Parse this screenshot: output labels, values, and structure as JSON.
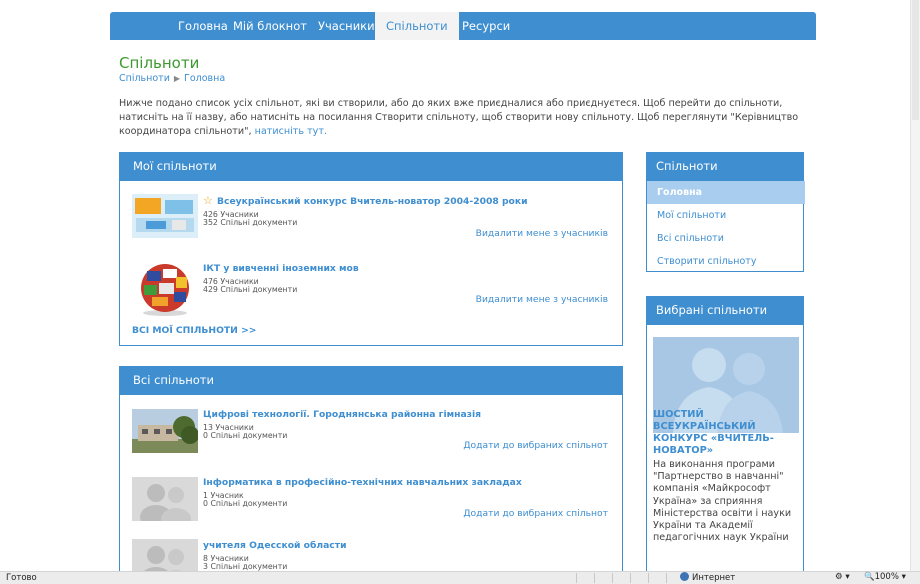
{
  "nav": {
    "items": [
      {
        "label": "Головна"
      },
      {
        "label": "Мій блокнот"
      },
      {
        "label": "Учасники"
      },
      {
        "label": "Спільноти"
      },
      {
        "label": "Ресурси"
      }
    ],
    "active": "Спільноти"
  },
  "page": {
    "title": "Спільноти",
    "breadcrumb": [
      "Спільноти",
      "Головна"
    ],
    "intro_text": "Нижче подано список усіх спільнот, які ви створили, або до яких вже приєдналися або приєднуєтеся. Щоб перейти до спільноти, натисніть на її назву, або натисніть на посилання Створити спільноту, щоб створити нову спільноту. Щоб переглянути \"Керівництво координатора спільноти\",",
    "intro_link": "натисніть тут."
  },
  "my_communities": {
    "heading": "Мої спільноти",
    "items": [
      {
        "title": "Всеукраїнський конкурс Вчитель-новатор 2004-2008 роки",
        "members": "426 Учасники",
        "docs": "352 Спільні документи",
        "action": "Видалити мене з учасників",
        "icon": "star-icon"
      },
      {
        "title": "ІКТ у вивченні іноземних мов",
        "members": "476 Учасники",
        "docs": "429 Спільні документи",
        "action": "Видалити мене з учасників"
      }
    ],
    "all_link": "ВСІ МОЇ СПІЛЬНОТИ >>"
  },
  "all_communities": {
    "heading": "Всі спільноти",
    "items": [
      {
        "title": "Цифрові технології. Городнянська районна гімназія",
        "members": "13 Учасники",
        "docs": "0 Спільні документи",
        "action": "Додати до вибраних спільнот"
      },
      {
        "title": "Інформатика в професійно-технічних навчальних закладах",
        "members": "1 Учасник",
        "docs": "0 Спільні документи",
        "action": "Додати до вибраних спільнот"
      },
      {
        "title": "учителя Одесской области",
        "members": "8 Учасники",
        "docs": "3 Спільні документи"
      }
    ]
  },
  "side_menu": {
    "heading": "Спільноти",
    "items": [
      {
        "label": "Головна"
      },
      {
        "label": "Мої спільноти"
      },
      {
        "label": "Всі спільноти"
      },
      {
        "label": "Створити спільноту"
      }
    ]
  },
  "favorites": {
    "heading": "Вибрані спільноти",
    "title": "ШОСТИЙ ВСЕУКРАЇНСЬКИЙ КОНКУРС «ВЧИТЕЛЬ-НОВАТОР»",
    "text": "На виконання програми \"Партнерство в навчанні\" компанія «Майкрософт Україна» за сприяння Міністерства освіти і науки України та Академії педагогічних наук України"
  },
  "status": {
    "left": "Готово",
    "zone": "Интернет",
    "zoom": "100%"
  },
  "colors": {
    "accent": "#3e8ed0",
    "title_green": "#3c9a2e"
  }
}
